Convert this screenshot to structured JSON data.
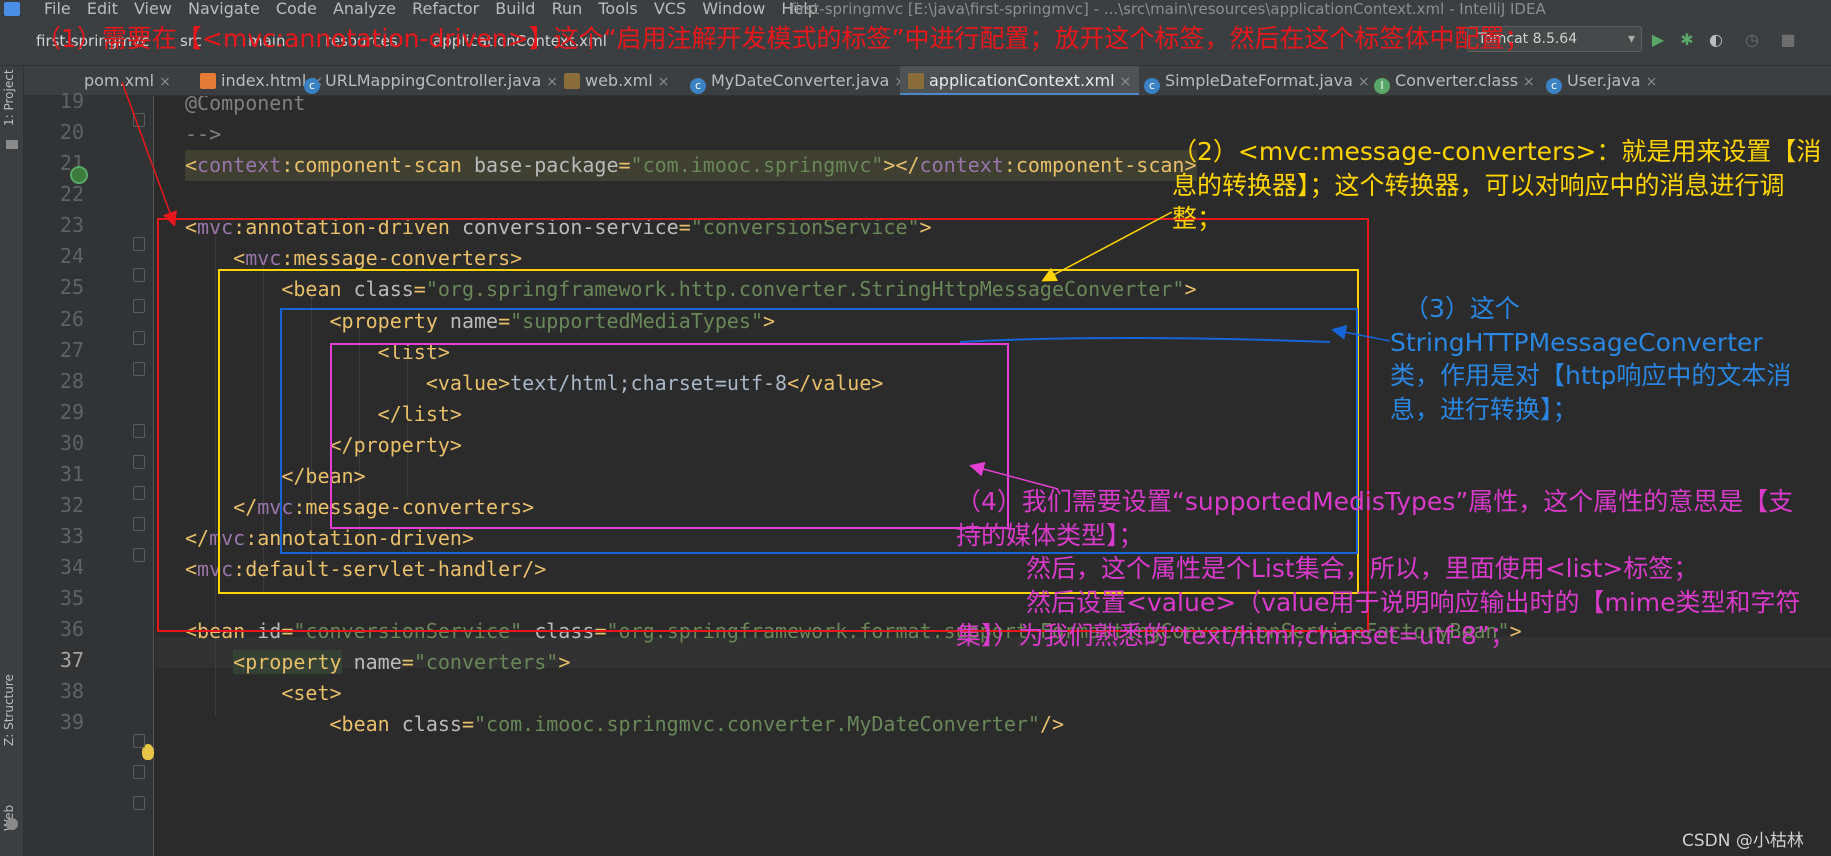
{
  "window": {
    "title": "first-springmvc [E:\\java\\first-springmvc] - ...\\src\\main\\resources\\applicationContext.xml - IntelliJ IDEA",
    "menu": [
      "File",
      "Edit",
      "View",
      "Navigate",
      "Code",
      "Analyze",
      "Refactor",
      "Build",
      "Run",
      "Tools",
      "VCS",
      "Window",
      "Help"
    ]
  },
  "navbar": {
    "breadcrumbs": [
      "first-springmvc",
      "src",
      "main",
      "resources",
      "applicationContext.xml"
    ],
    "run_config": "Tomcat 8.5.64"
  },
  "tabs": [
    {
      "label": "pom.xml",
      "icon": "maven-icon"
    },
    {
      "label": "index.html",
      "icon": "html-icon"
    },
    {
      "label": "URLMappingController.java",
      "icon": "class-icon"
    },
    {
      "label": "web.xml",
      "icon": "xml-icon"
    },
    {
      "label": "MyDateConverter.java",
      "icon": "class-icon"
    },
    {
      "label": "applicationContext.xml",
      "icon": "xml-icon",
      "active": true
    },
    {
      "label": "SimpleDateFormat.java",
      "icon": "class-icon"
    },
    {
      "label": "Converter.class",
      "icon": "interface-icon"
    },
    {
      "label": "User.java",
      "icon": "class-icon"
    }
  ],
  "side_panels": {
    "project": "1: Project",
    "structure": "Z: Structure",
    "web": "Web"
  },
  "editor": {
    "line_numbers": [
      "19",
      "20",
      "21",
      "22",
      "23",
      "24",
      "25",
      "26",
      "27",
      "28",
      "29",
      "30",
      "31",
      "32",
      "33",
      "34",
      "35",
      "36",
      "37",
      "38",
      "39"
    ],
    "current_line": "37"
  },
  "annotations": {
    "note1": "（1）需要在【<mvc:annotation-driven>】这个“启用注解开发模式的标签”中进行配置；放开这个标签，然后在这个标签体中配置；",
    "note2": "（2）<mvc:message-converters>：就是用来设置【消息的转换器】；这个转换器，可以对响应中的消息进行调整；",
    "note3_l1": "（3）这个",
    "note3_l2": "StringHTTPMessageConverter",
    "note3_l3": "类，作用是对【http响应中的文本消息，进行转换】；",
    "note4_l1": "（4）我们需要设置“supportedMedisTypes”属性，这个属性的意思是【支持的媒体类型】；",
    "note4_l2": "然后，这个属性是个List集合，所以，里面使用<list>标签；",
    "note4_l3": "然后设置<value>（value用于说明响应输出时的【mime类型和字符集】）为我们熟悉的“text/html;charset=utf-8”；"
  },
  "colors": {
    "red": "#e8171b",
    "yellow": "#ffd400",
    "blue": "#1565d8",
    "magenta": "#e63fd3",
    "note_blue": "#2a86e0",
    "note_magenta": "#d83bc9"
  },
  "watermark": "CSDN @小枯林"
}
